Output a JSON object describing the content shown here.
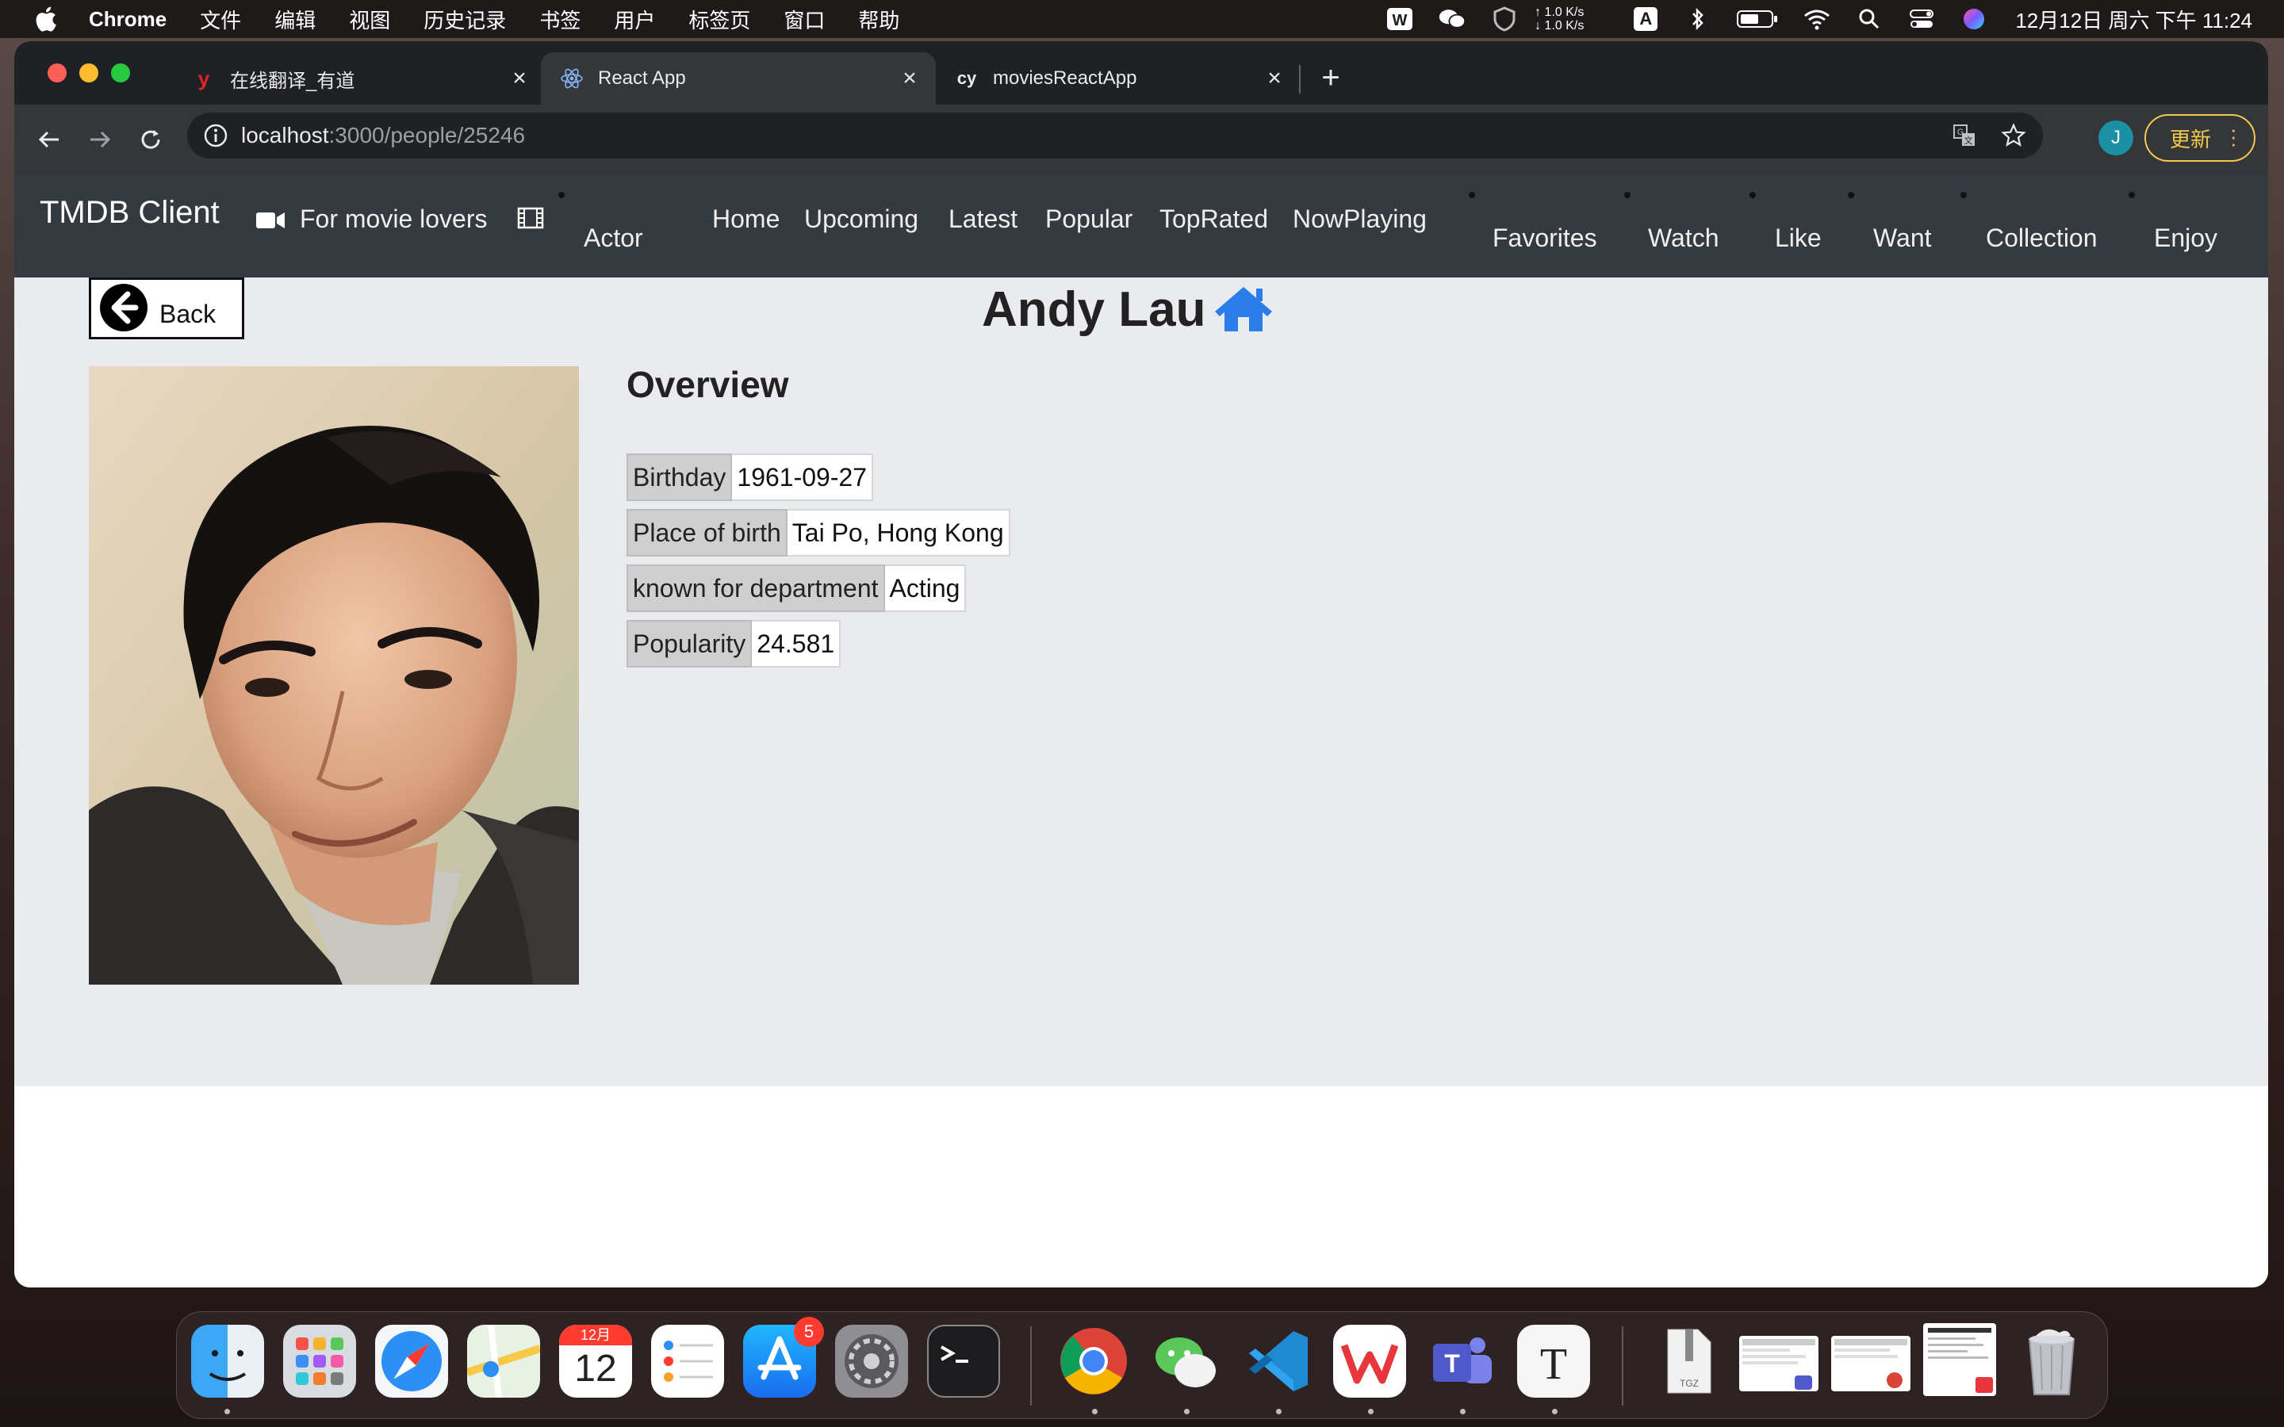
{
  "menubar": {
    "app_name": "Chrome",
    "items": [
      "文件",
      "编辑",
      "视图",
      "历史记录",
      "书签",
      "用户",
      "标签页",
      "窗口",
      "帮助"
    ],
    "net_up": "↑ 1.0 K/s",
    "net_down": "↓ 1.0 K/s",
    "input_method": "A",
    "clock": "12月12日 周六 下午 11:24"
  },
  "tabs": [
    {
      "title": "在线翻译_有道",
      "favicon": "y"
    },
    {
      "title": "React App",
      "favicon": "react-icon"
    },
    {
      "title": "moviesReactApp",
      "favicon": "cy"
    }
  ],
  "address": {
    "host": "localhost",
    "path": ":3000/people/25246"
  },
  "profile_initial": "J",
  "update_label": "更新",
  "navbar": {
    "brand": "TMDB Client",
    "tagline": "For movie lovers",
    "actor": "Actor",
    "links": [
      "Home",
      "Upcoming",
      "Latest",
      "Popular",
      "TopRated",
      "NowPlaying"
    ],
    "lists": [
      "Favorites",
      "Watch",
      "Like",
      "Want",
      "Collection",
      "Enjoy"
    ]
  },
  "person": {
    "back_label": "Back",
    "name": "Andy Lau",
    "overview_heading": "Overview",
    "details": [
      {
        "label": "Birthday",
        "value": "1961-09-27"
      },
      {
        "label": "Place of birth",
        "value": "Tai Po, Hong Kong"
      },
      {
        "label": "known for department",
        "value": "Acting"
      },
      {
        "label": "Popularity",
        "value": "24.581"
      }
    ]
  },
  "dock": {
    "calendar_month": "12月",
    "calendar_day": "12",
    "appstore_badge": "5",
    "tgz_label": "TGZ"
  },
  "colors": {
    "navbar_bg": "#343a40",
    "content_bg": "#e9ebee",
    "home_icon": "#2b7de9",
    "update_accent": "#f2c94c"
  }
}
